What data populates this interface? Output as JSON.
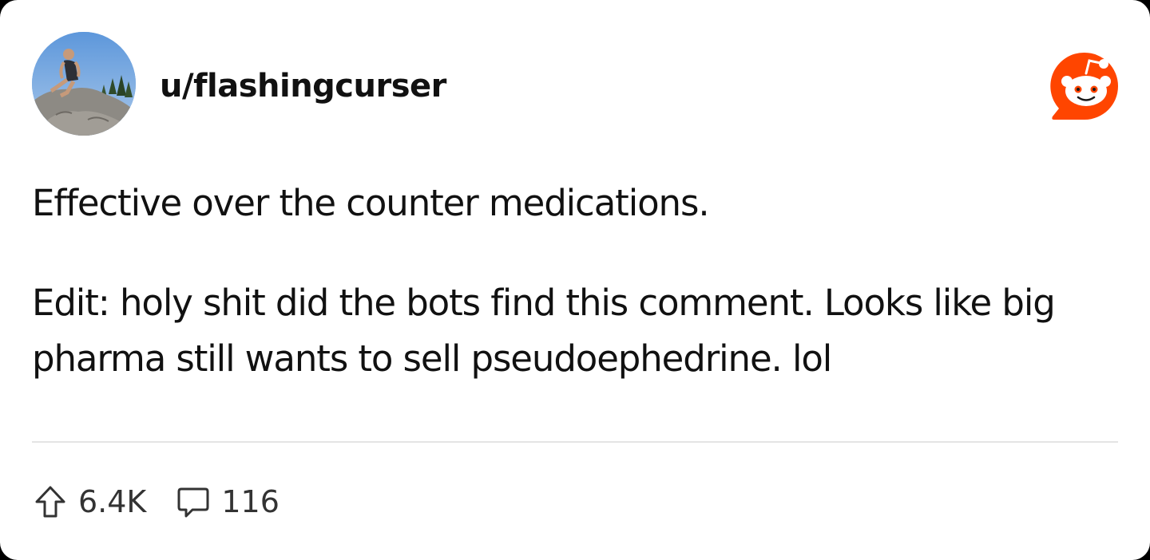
{
  "post": {
    "username": "u/flashingcurser",
    "body_paragraphs": [
      "Effective over the counter medications.",
      "Edit: holy shit did the bots find this comment. Looks like big pharma still wants to sell pseudoephedrine. lol"
    ],
    "upvotes": "6.4K",
    "comments": "116"
  },
  "icons": {
    "brand": "reddit-logo-icon",
    "upvote": "upvote-arrow-icon",
    "comment": "comment-bubble-icon"
  },
  "colors": {
    "reddit_orange": "#ff4500",
    "text": "#111111",
    "divider": "#e4e4e4",
    "background": "#ffffff"
  }
}
